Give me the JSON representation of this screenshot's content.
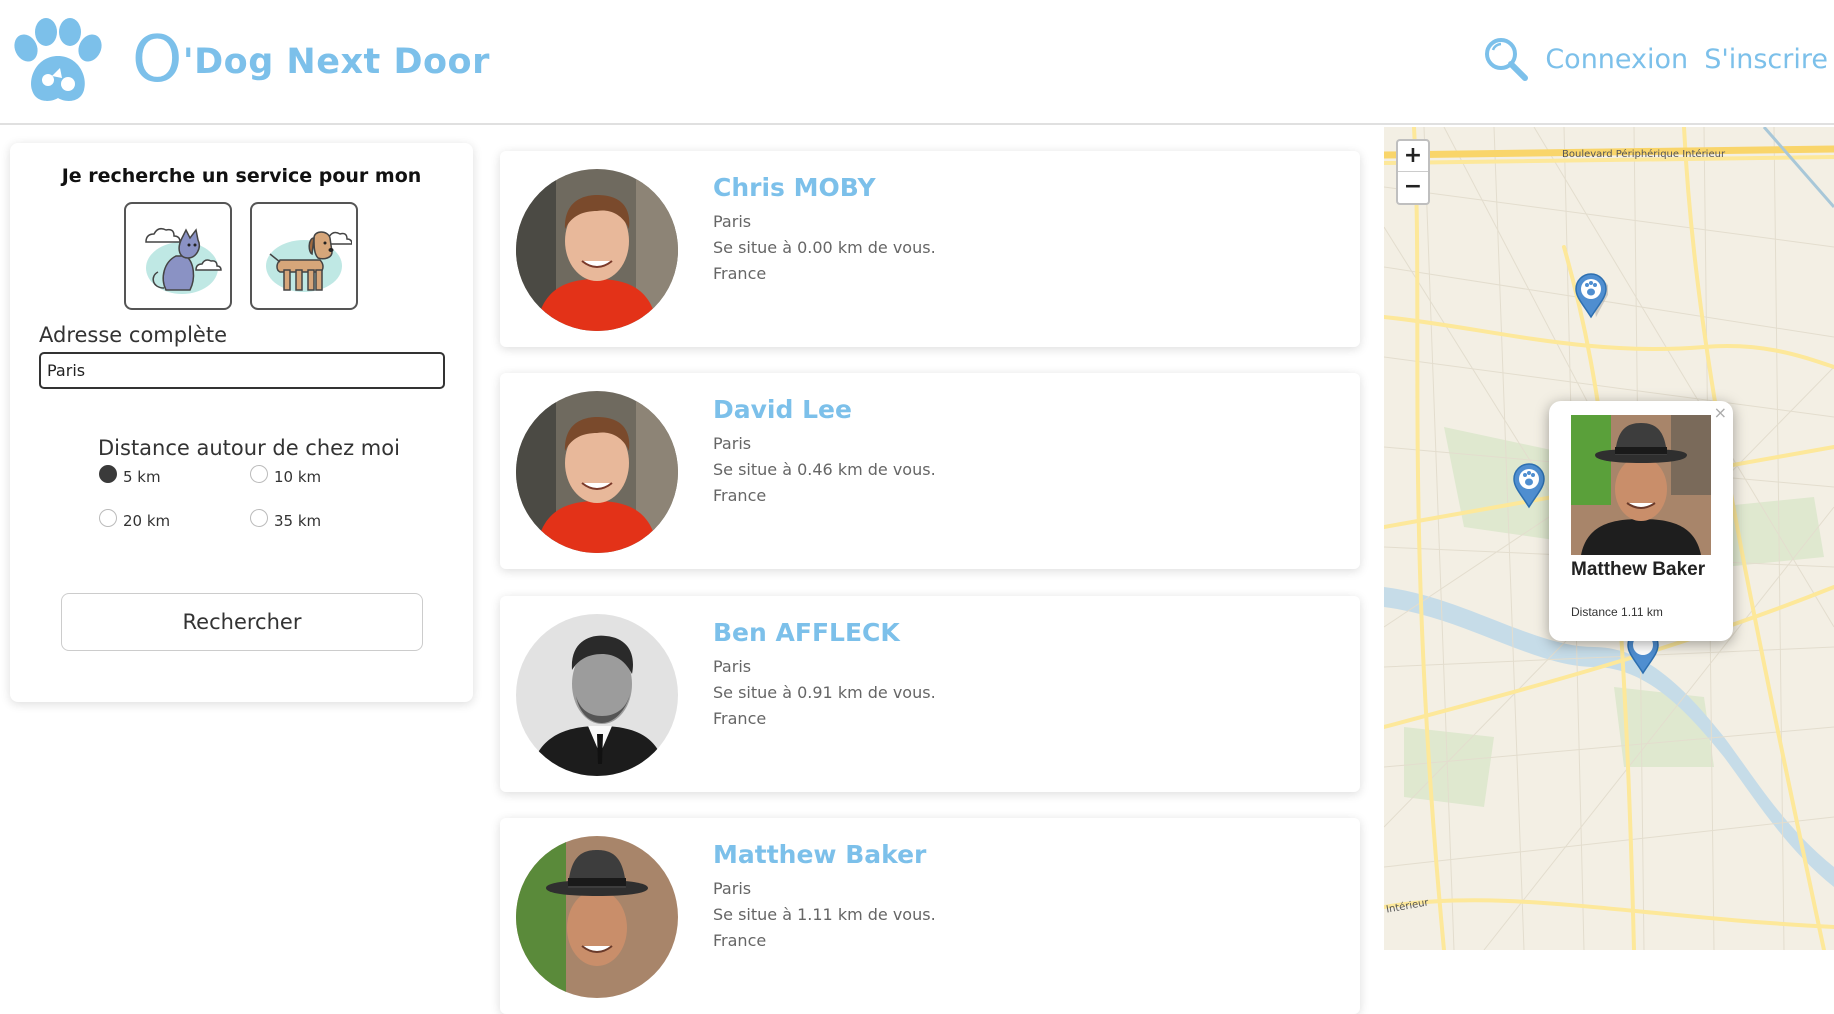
{
  "header": {
    "title_first_letter": "O",
    "title_rest": "'Dog Next Door",
    "login_label": "Connexion",
    "signup_label": "S'inscrire"
  },
  "search_panel": {
    "title": "Je recherche un service pour mon",
    "address_label": "Adresse complète",
    "address_value": "Paris",
    "distance_label": "Distance autour de chez moi",
    "distance_options": [
      {
        "label": "5 km",
        "checked": true
      },
      {
        "label": "10 km",
        "checked": false
      },
      {
        "label": "20 km",
        "checked": false
      },
      {
        "label": "35 km",
        "checked": false
      }
    ],
    "search_button": "Rechercher"
  },
  "results": [
    {
      "name": "Chris MOBY",
      "city": "Paris",
      "distance_text": "Se situe à 0.00 km de vous.",
      "country": "France"
    },
    {
      "name": "David Lee",
      "city": "Paris",
      "distance_text": "Se situe à 0.46 km de vous.",
      "country": "France"
    },
    {
      "name": "Ben AFFLECK",
      "city": "Paris",
      "distance_text": "Se situe à 0.91 km de vous.",
      "country": "France"
    },
    {
      "name": "Matthew Baker",
      "city": "Paris",
      "distance_text": "Se situe à 1.11 km de vous.",
      "country": "France"
    }
  ],
  "map": {
    "zoom_in": "+",
    "zoom_out": "−",
    "road_label_top": "Boulevard Périphérique Intérieur",
    "road_label_bottom": "Intérieur",
    "popup": {
      "close": "×",
      "name": "Matthew Baker",
      "distance": "Distance 1.11 km"
    }
  },
  "colors": {
    "brand": "#7cc0ea",
    "text_muted": "#666666"
  }
}
